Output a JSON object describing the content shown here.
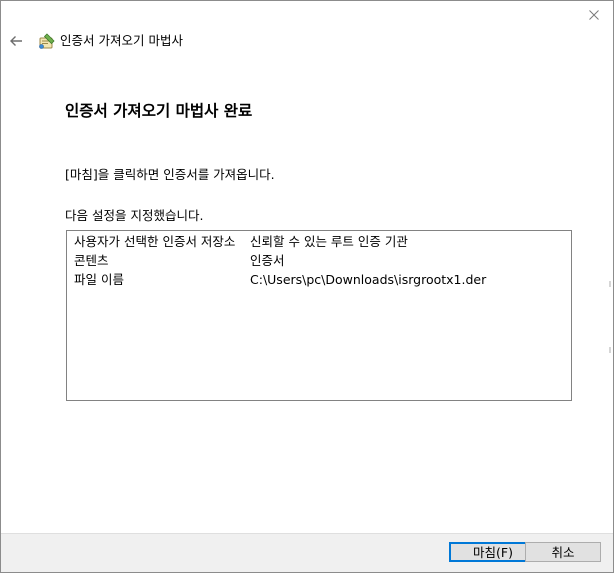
{
  "window": {
    "title": "인증서 가져오기 마법사"
  },
  "icons": {
    "close": "close-icon",
    "back": "back-arrow-icon",
    "wizard": "certificate-wizard-icon"
  },
  "page": {
    "heading": "인증서 가져오기 마법사 완료",
    "instruction": "[마침]을 클릭하면 인증서를 가져옵니다.",
    "settings_label": "다음 설정을 지정했습니다."
  },
  "settings": [
    {
      "key": "사용자가 선택한 인증서 저장소",
      "value": "신뢰할 수 있는 루트 인증 기관"
    },
    {
      "key": "콘텐츠",
      "value": "인증서"
    },
    {
      "key": "파일 이름",
      "value": "C:\\Users\\pc\\Downloads\\isrgrootx1.der"
    }
  ],
  "buttons": {
    "finish": "마침(F)",
    "cancel": "취소"
  },
  "colors": {
    "focus_border": "#0078d7",
    "footer_bg": "#f0f0f0",
    "button_bg": "#e1e1e1"
  }
}
